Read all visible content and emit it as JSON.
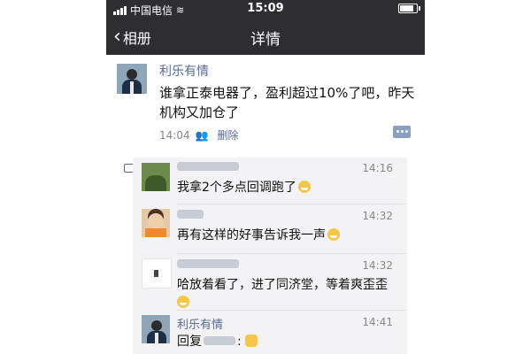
{
  "statusbar": {
    "carrier": "中国电信",
    "time": "15:09"
  },
  "nav": {
    "back_label": "相册",
    "title": "详情"
  },
  "post": {
    "author": "利乐有情",
    "text": "谁拿正泰电器了，盈利超过10%了吧，昨天机构又加仓了",
    "time": "14:04",
    "delete_label": "删除"
  },
  "comments": [
    {
      "time": "14:16",
      "text": "我拿2个多点回调跑了"
    },
    {
      "time": "14:32",
      "text": "再有这样的好事告诉我一声"
    },
    {
      "time": "14:32",
      "text": "哈放着看了，进了同济堂，等着爽歪歪"
    },
    {
      "name": "利乐有情",
      "time": "14:41",
      "text": "回复",
      "suffix": ":"
    }
  ]
}
